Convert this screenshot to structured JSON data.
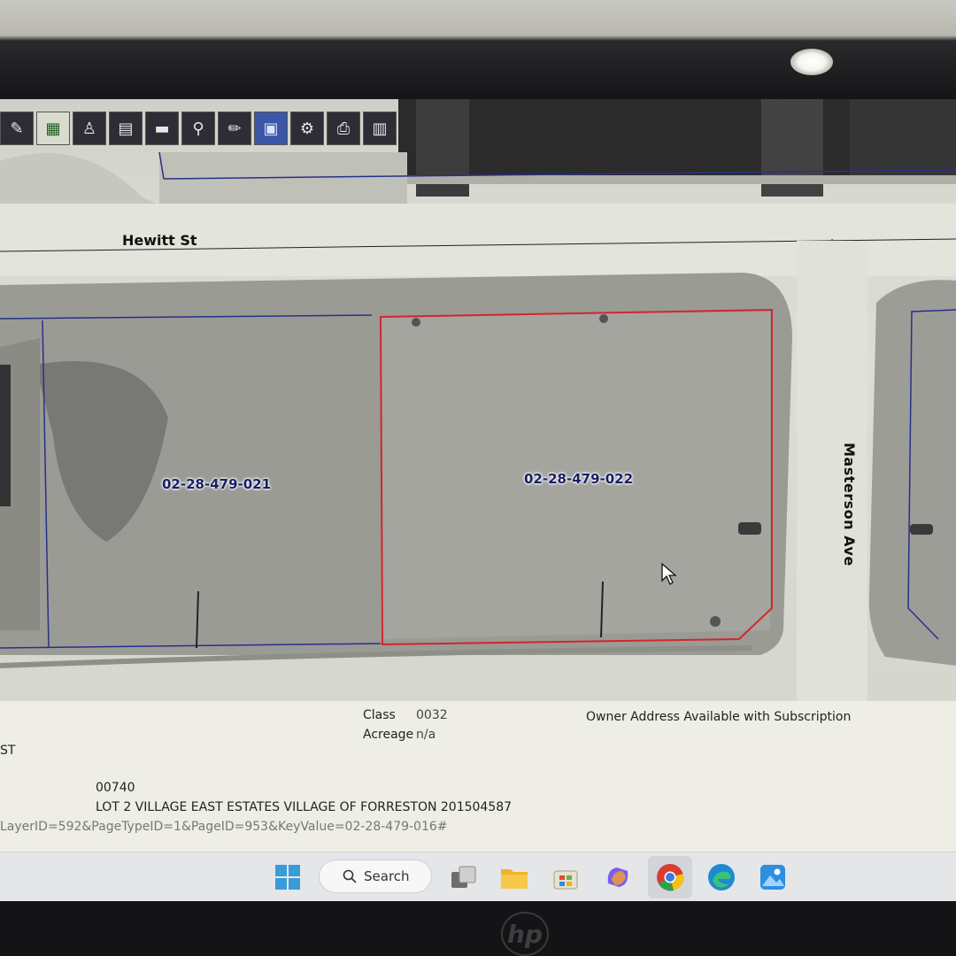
{
  "toolbar": {
    "tools": [
      "eraser-icon",
      "grid-icon",
      "person-icon",
      "book-icon",
      "ruler-icon",
      "pin-icon",
      "pencil-icon",
      "screen-icon",
      "settings-icon",
      "print-icon",
      "save-icon"
    ]
  },
  "map": {
    "streets": {
      "north": "Hewitt St",
      "east": "Masterson Ave"
    },
    "parcels": {
      "left": "02-28-479-021",
      "selected": "02-28-479-022"
    },
    "selection_color": "#d4242e",
    "boundary_color": "#2a2f8a"
  },
  "info": {
    "class_label": "Class",
    "class_value": "0032",
    "acreage_label": "Acreage",
    "acreage_value": "n/a",
    "owner_text": "Owner Address Available with Subscription",
    "partial_text": "ST",
    "code": "00740",
    "legal_description": "LOT 2 VILLAGE EAST ESTATES VILLAGE OF FORRESTON 201504587",
    "url_fragment": "LayerID=592&PageTypeID=1&PageID=953&KeyValue=02-28-479-016#"
  },
  "taskbar": {
    "search_label": "Search",
    "apps": [
      "windows-start-icon",
      "task-view-icon",
      "file-explorer-icon",
      "microsoft-store-icon",
      "copilot-icon",
      "chrome-icon",
      "edge-icon",
      "photos-icon"
    ]
  },
  "device": {
    "brand": "hp"
  }
}
